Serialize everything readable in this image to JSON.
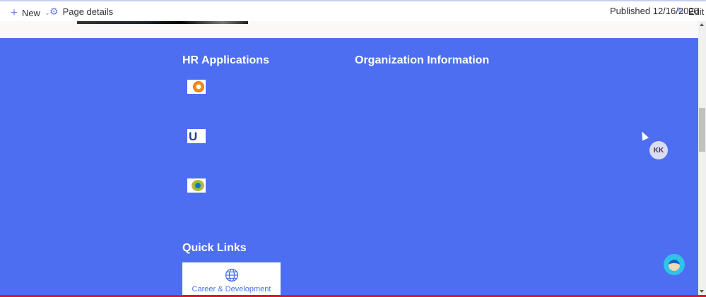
{
  "toolbar": {
    "new_label": "New",
    "page_details_label": "Page details",
    "published": "Published 12/16/2020",
    "edit_label": "Edit"
  },
  "sections": {
    "hr_apps": "HR Applications",
    "org_info": "Organization Information",
    "quick_links": "Quick Links"
  },
  "quick_links": [
    {
      "label": "Career & Development",
      "icon": "globe-icon"
    }
  ],
  "avatar": {
    "initials": "KK"
  },
  "colors": {
    "accent": "#4e6ef2"
  }
}
